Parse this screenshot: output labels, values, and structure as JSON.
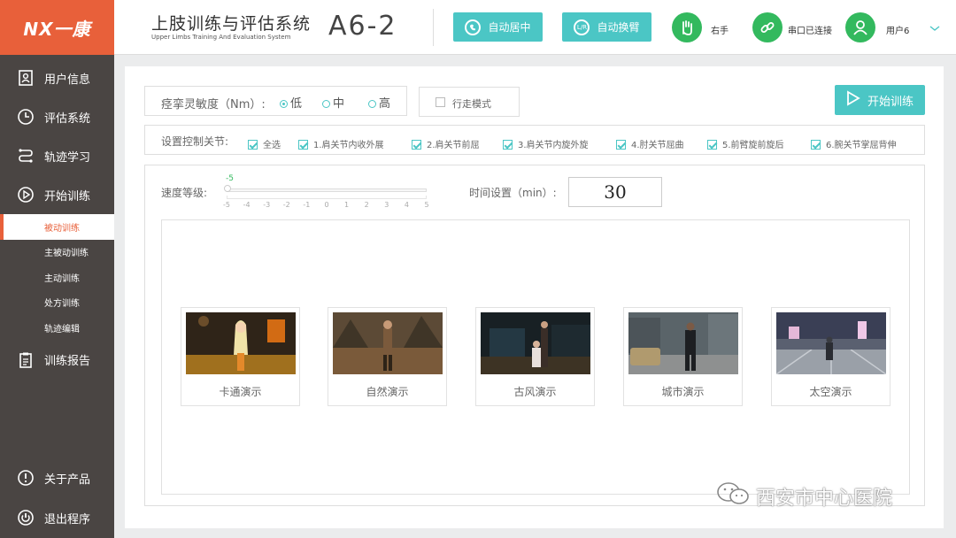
{
  "logo": "NX一康",
  "nav": [
    {
      "label": "用户信息",
      "icon": "user-info-icon"
    },
    {
      "label": "评估系统",
      "icon": "clock-icon"
    },
    {
      "label": "轨迹学习",
      "icon": "path-icon"
    },
    {
      "label": "开始训练",
      "icon": "play-icon"
    }
  ],
  "sub": [
    {
      "label": "被动训练",
      "active": true
    },
    {
      "label": "主被动训练"
    },
    {
      "label": "主动训练"
    },
    {
      "label": "处方训练"
    },
    {
      "label": "轨迹编辑"
    }
  ],
  "nav2": [
    {
      "label": "训练报告",
      "icon": "report-icon"
    }
  ],
  "nav_bottom": [
    {
      "label": "关于产品",
      "icon": "info-icon"
    },
    {
      "label": "退出程序",
      "icon": "power-icon"
    }
  ],
  "header": {
    "title": "上肢训练与评估系统",
    "subtitle": "Upper Limbs Training And Evaluation System",
    "model": "A6-2",
    "btn_center": "自动居中",
    "btn_center_icon_text": "",
    "btn_swap": "自动换臂",
    "btn_swap_icon_text": "L/R",
    "hand": "右手",
    "serial": "串口已连接",
    "user": "用户6"
  },
  "sensitivity": {
    "label": "痉挛灵敏度（Nm）:",
    "options": [
      "低",
      "中",
      "高"
    ],
    "selected": 0
  },
  "walk_mode": "行走模式",
  "start_btn": "开始训练",
  "joints": {
    "label": "设置控制关节:",
    "items": [
      "全选",
      "1.肩关节内收外展",
      "2.肩关节前屈",
      "3.肩关节内旋外旋",
      "4.肘关节屈曲",
      "5.前臂旋前旋后",
      "6.腕关节掌屈背伸"
    ]
  },
  "speed": {
    "label": "速度等级:",
    "value": "-5",
    "ticks": [
      "-5",
      "-4",
      "-3",
      "-2",
      "-1",
      "0",
      "1",
      "2",
      "3",
      "4",
      "5"
    ]
  },
  "time": {
    "label": "时间设置（min）:",
    "value": "30"
  },
  "scenes": [
    "卡通演示",
    "自然演示",
    "古风演示",
    "城市演示",
    "太空演示"
  ],
  "watermark": "西安市中心医院",
  "colors": {
    "accent": "#e8603a",
    "teal": "#4bc6c5",
    "green": "#33b95e",
    "sidebar": "#4a4543"
  }
}
